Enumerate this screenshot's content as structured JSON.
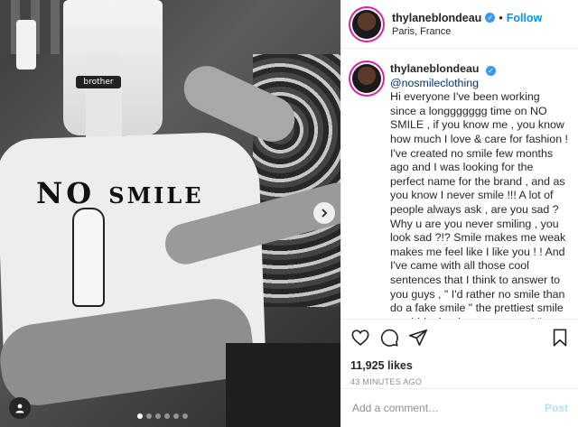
{
  "post": {
    "username": "thylaneblondeau",
    "follow_label": "Follow",
    "separator": "•",
    "location": "Paris, France",
    "photo_brand_text": "brother",
    "photo_print_text_1": "NO",
    "photo_print_text_2": "SMILE"
  },
  "caption": {
    "username": "thylaneblondeau",
    "mention": "@nosmileclothing",
    "text": "Hi everyone I've been working since a longgggggg time on NO SMILE , if you know me , you know how much I love & care for fashion !\nI've created no smile few months ago and I was looking for the perfect name for the brand , and as you know I never smile !!! A lot of people always ask , are you sad ? Why u are you never smiling , you look sad ?!? Smile makes me weak makes me feel like I like you ! ! And I've came with all those cool sentences that I think to answer to you guys , \" I'd rather no smile than do a fake smile \" the prettiest smile can hide the deepest secret \" \" everyone can smile why would I \" She'll smile when she wants too, don't force it \" and as Victoria's said \" i have a responsibility"
  },
  "stats": {
    "likes": "11,925 likes",
    "time_ago": "43 MINUTES AGO"
  },
  "comment": {
    "placeholder": "Add a comment…",
    "post_label": "Post"
  },
  "carousel": {
    "total": 6,
    "active_index": 0
  },
  "colors": {
    "accent": "#0095f6",
    "verified": "#3897f0",
    "post_disabled": "#b2dffc",
    "muted": "#8e8e8e"
  },
  "icons": [
    "heart-icon",
    "comment-icon",
    "share-icon",
    "bookmark-icon",
    "user-tag-icon",
    "chevron-right-icon",
    "verified-icon"
  ]
}
